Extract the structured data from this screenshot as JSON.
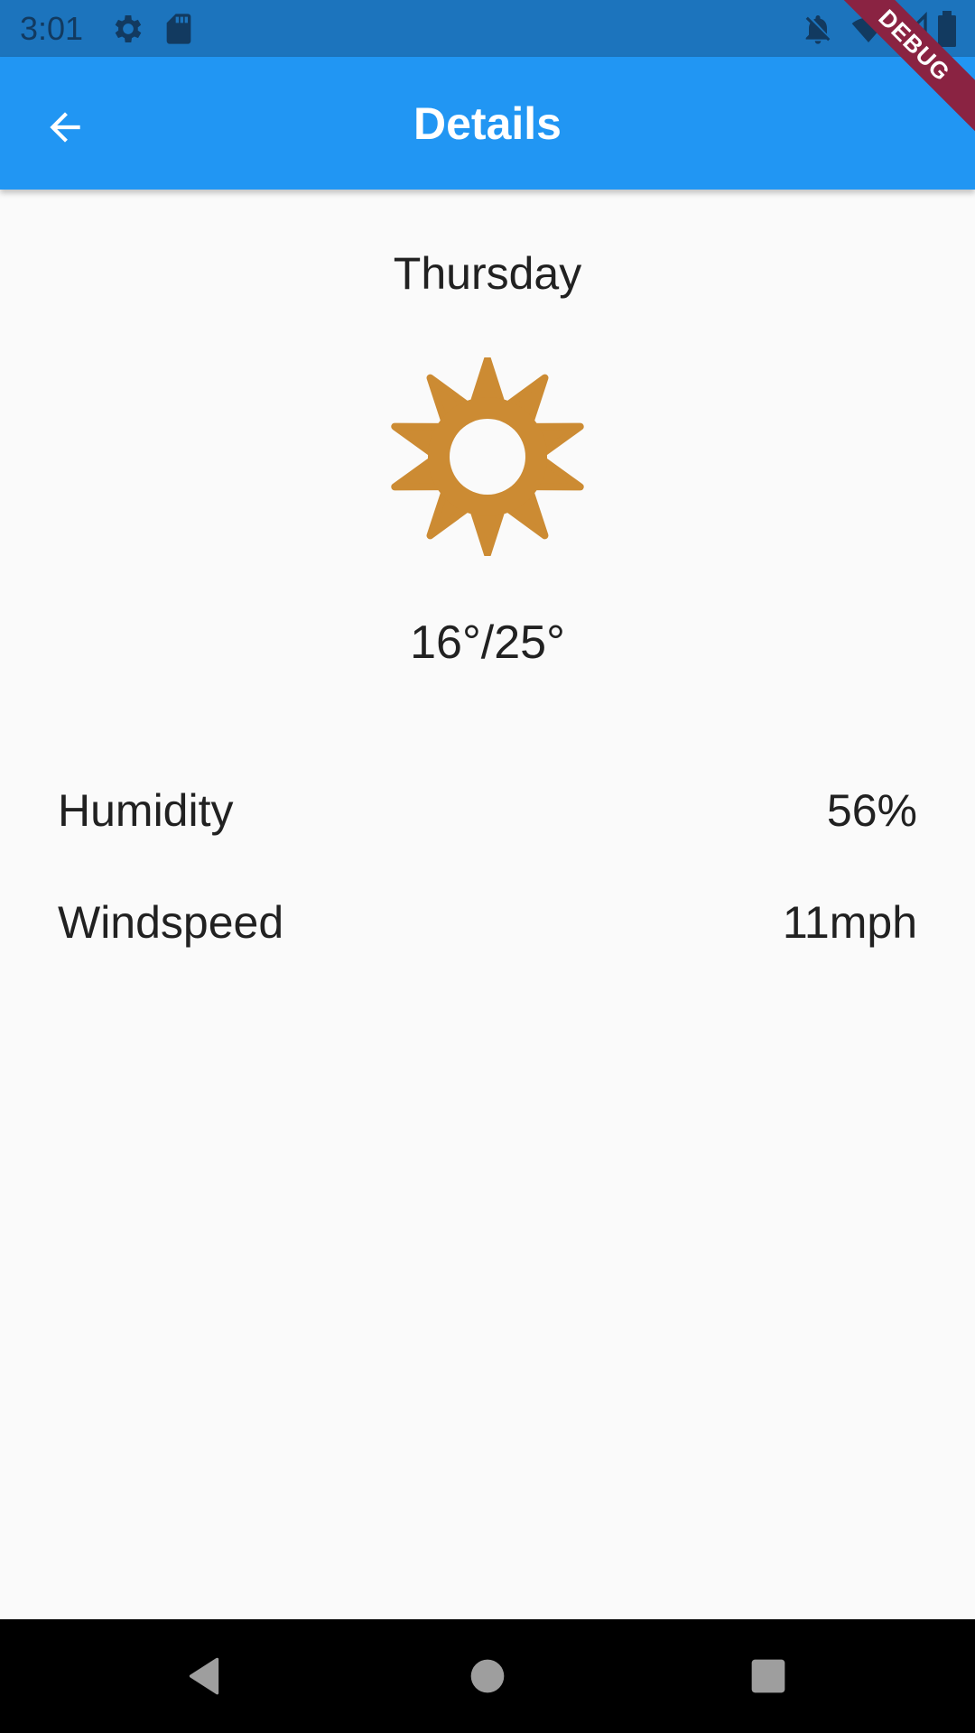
{
  "status_bar": {
    "time": "3:01",
    "icons": [
      "gear-icon",
      "sd-card-icon",
      "notifications-off-icon",
      "wifi-icon",
      "signal-icon",
      "battery-icon"
    ]
  },
  "app_bar": {
    "title": "Details",
    "back_icon": "arrow-back-icon",
    "debug_label": "DEBUG",
    "color": "#2196f3"
  },
  "weather": {
    "day": "Thursday",
    "icon": "sun-icon",
    "icon_color": "#cc8b33",
    "temperature": "16°/25°"
  },
  "details": [
    {
      "label": "Humidity",
      "value": "56%"
    },
    {
      "label": "Windspeed",
      "value": "11mph"
    }
  ],
  "nav_bar": {
    "buttons": [
      "back-triangle-icon",
      "home-circle-icon",
      "recents-square-icon"
    ]
  }
}
